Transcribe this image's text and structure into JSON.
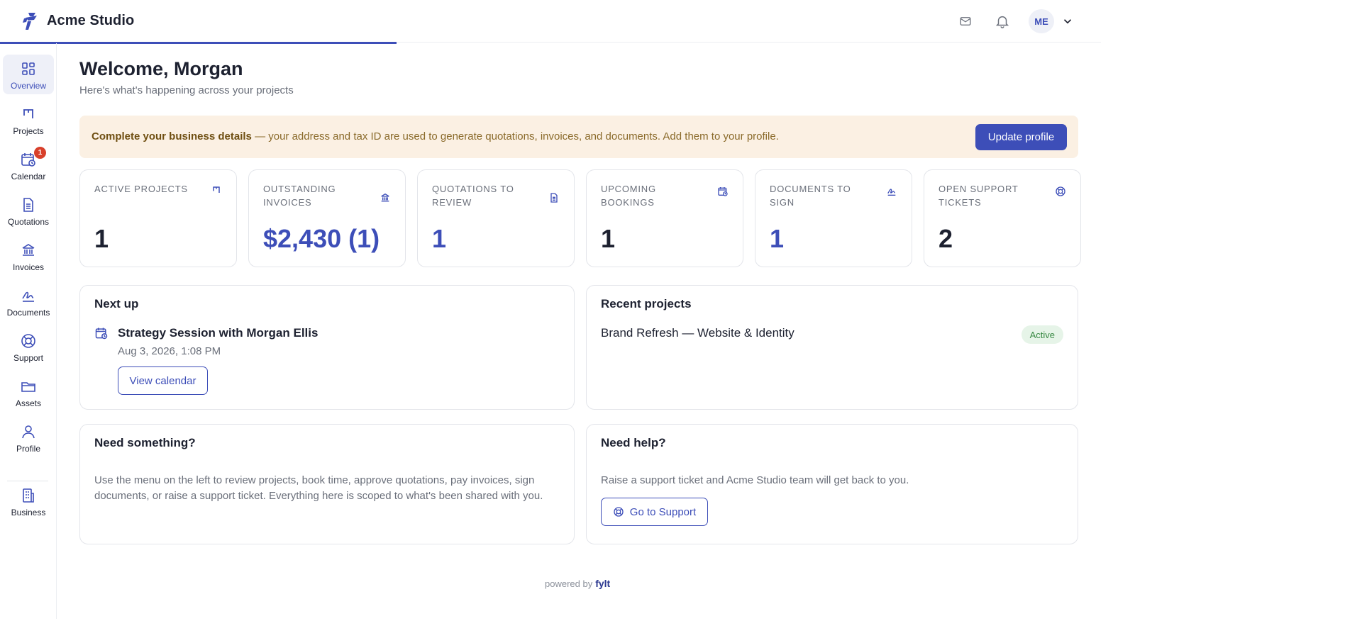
{
  "header": {
    "brand_name": "Acme Studio",
    "avatar_initials": "ME",
    "progress_fraction": 0.36
  },
  "sidebar": {
    "items": [
      {
        "label": "Overview",
        "icon": "grid-icon"
      },
      {
        "label": "Projects",
        "icon": "kanban-icon"
      },
      {
        "label": "Calendar",
        "icon": "calendar-clock-icon",
        "badge": "1"
      },
      {
        "label": "Quotations",
        "icon": "document-icon"
      },
      {
        "label": "Invoices",
        "icon": "bank-icon"
      },
      {
        "label": "Documents",
        "icon": "signature-icon"
      },
      {
        "label": "Support",
        "icon": "lifebuoy-icon"
      },
      {
        "label": "Assets",
        "icon": "folder-icon"
      },
      {
        "label": "Profile",
        "icon": "user-icon"
      },
      {
        "label": "Business",
        "icon": "building-icon"
      }
    ]
  },
  "main": {
    "title": "Welcome, Morgan",
    "subtitle": "Here's what's happening across your projects",
    "alert": {
      "strong": "Complete your business details",
      "text": " — your address and tax ID are used to generate quotations, invoices, and documents. Add them to your profile.",
      "button": "Update profile"
    },
    "stats": [
      {
        "label": "ACTIVE PROJECTS",
        "value": "1"
      },
      {
        "label": "OUTSTANDING INVOICES",
        "value": "$2,430 (1)"
      },
      {
        "label": "QUOTATIONS TO REVIEW",
        "value": "1"
      },
      {
        "label": "UPCOMING BOOKINGS",
        "value": "1"
      },
      {
        "label": "DOCUMENTS TO SIGN",
        "value": "1"
      },
      {
        "label": "OPEN SUPPORT TICKETS",
        "value": "2"
      }
    ],
    "next_up": {
      "title": "Next up",
      "event_title": "Strategy Session with Morgan Ellis",
      "event_date": "Aug 3, 2026, 1:08 PM",
      "button": "View calendar"
    },
    "recent_projects": {
      "title": "Recent projects",
      "items": [
        {
          "name": "Brand Refresh — Website & Identity",
          "status": "Active"
        }
      ]
    },
    "need_something": {
      "title": "Need something?",
      "text": "Use the menu on the left to review projects, book time, approve quotations, pay invoices, sign documents, or raise a support ticket. Everything here is scoped to what's been shared with you."
    },
    "need_help": {
      "title": "Need help?",
      "text": "Raise a support ticket and Acme Studio team will get back to you.",
      "button": "Go to Support"
    },
    "footer": {
      "prefix": "powered by",
      "brand": "fylt"
    }
  },
  "colors": {
    "accent": "#3d4eb8",
    "alert_bg": "#fbf0e3",
    "badge": "#d8402b",
    "status_active_bg": "#e6f4e8"
  }
}
